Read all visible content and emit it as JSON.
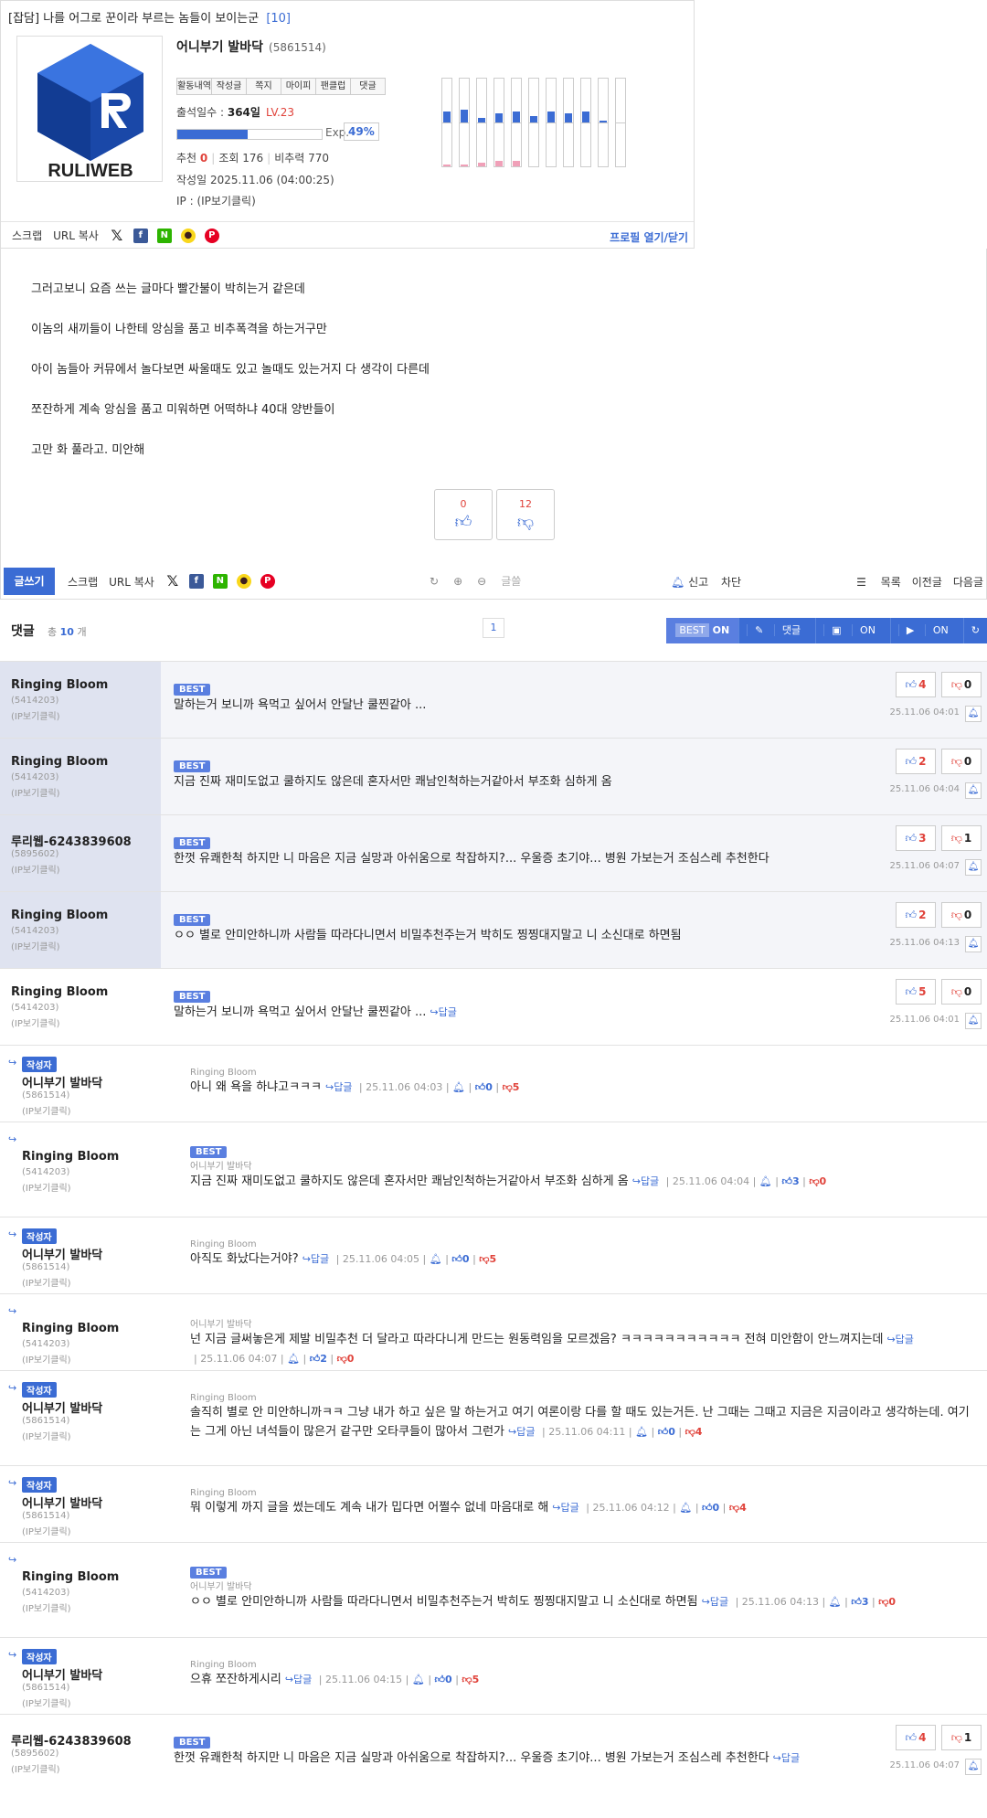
{
  "post": {
    "category": "[잡담]",
    "title": "나를 어그로 꾼이라 부르는 놈들이 보이는군",
    "comment_count": "[10]",
    "logo_text": "RULIWEB",
    "nick": "어니부기 발바닥",
    "uid": "(5861514)",
    "tabs": [
      "활동내역",
      "작성글",
      "쪽지",
      "마이피",
      "팬클럽",
      "댓글"
    ],
    "attend_label": "출석일수 :",
    "attend_value": "364일",
    "level": "LV.23",
    "exp_label": "Exp.",
    "exp_pct": "49%",
    "exp_fraction": 0.49,
    "recommend_label": "추천",
    "recommend": "0",
    "views_label": "조회",
    "views": "176",
    "ratio_label": "비추력",
    "ratio": "770",
    "date_label": "작성일",
    "date": "2025.11.06 (04:00:25)",
    "ip": "IP : (IP보기클릭)",
    "share": {
      "scrap": "스크랩",
      "url_copy": "URL 복사",
      "profile_toggle": "프로필 열기/닫기"
    },
    "activity_bars": [
      {
        "up": 0.25,
        "down": 0.05
      },
      {
        "up": 0.3,
        "down": 0.05
      },
      {
        "up": 0.1,
        "down": 0.08
      },
      {
        "up": 0.2,
        "down": 0.12
      },
      {
        "up": 0.25,
        "down": 0.12
      },
      {
        "up": 0.15,
        "down": 0.0
      },
      {
        "up": 0.25,
        "down": 0.0
      },
      {
        "up": 0.2,
        "down": 0.0
      },
      {
        "up": 0.25,
        "down": 0.0
      },
      {
        "up": 0.05,
        "down": 0.0
      },
      {
        "up": 0.0,
        "down": 0.0
      }
    ],
    "body": [
      "그러고보니 요즘 쓰는 글마다 빨간불이 박히는거 같은데",
      "이놈의 새끼들이 나한테 앙심을 품고 비추폭격을 하는거구만",
      "아이 놈들아 커뮤에서 놀다보면 싸울때도 있고 놀때도 있는거지 다 생각이 다른데",
      "쪼잔하게 계속 앙심을 품고 미워하면 어떡하냐 40대 양반들이",
      "고만 화 풀라고. 미안해"
    ],
    "vote_up": "0",
    "vote_down": "12"
  },
  "bottom_bar": {
    "write": "글쓰기",
    "scrap": "스크랩",
    "url_copy": "URL 복사",
    "search_placeholder": "글쓸",
    "report": "신고",
    "block": "차단",
    "list": "목록",
    "prev": "이전글",
    "next": "다음글"
  },
  "comment_header": {
    "title": "댓글",
    "total_label": "총",
    "total": "10",
    "total_unit": "개",
    "page": "1",
    "best_label": "BEST",
    "best_state": "ON",
    "reply_label": "댓글",
    "img_label": "ON",
    "video_label": "ON"
  },
  "comments": [
    {
      "type": "best",
      "name": "Ringing Bloom",
      "uid": "(5414203)",
      "ip": "(IP보기클릭)",
      "badge": "BEST",
      "text": "말하는거 보니까 욕먹고 싶어서 안달난 쿨찐같아 ...",
      "up": "4",
      "down": "0",
      "time": "25.11.06 04:01"
    },
    {
      "type": "best",
      "name": "Ringing Bloom",
      "uid": "(5414203)",
      "ip": "(IP보기클릭)",
      "badge": "BEST",
      "text": "지금 진짜 재미도없고 쿨하지도 않은데 혼자서만 쾌남인척하는거같아서 부조화 심하게 옴",
      "up": "2",
      "down": "0",
      "time": "25.11.06 04:04"
    },
    {
      "type": "best",
      "name": "루리웹-6243839608",
      "uid": "(5895602)",
      "ip": "(IP보기클릭)",
      "badge": "BEST",
      "text": "한껏 유쾌한척 하지만 니 마음은 지금 실망과 아쉬움으로 착잡하지?... 우울증 초기야... 병원 가보는거 조심스레 추천한다",
      "up": "3",
      "down": "1",
      "time": "25.11.06 04:07"
    },
    {
      "type": "best",
      "name": "Ringing Bloom",
      "uid": "(5414203)",
      "ip": "(IP보기클릭)",
      "badge": "BEST",
      "text": "ㅇㅇ 별로 안미안하니까 사람들 따라다니면서 비밀추천주는거 박히도 찡찡대지말고 니 소신대로 하면됨",
      "up": "2",
      "down": "0",
      "time": "25.11.06 04:13"
    },
    {
      "type": "normal",
      "name": "Ringing Bloom",
      "uid": "(5414203)",
      "ip": "(IP보기클릭)",
      "badge": "BEST",
      "text": "말하는거 보니까 욕먹고 싶어서 안달난 쿨찐같아 ...",
      "reply": "답글",
      "up": "5",
      "down": "0",
      "time": "25.11.06 04:01"
    },
    {
      "type": "reply",
      "author": "작성자",
      "name": "어니부기 발바닥",
      "uid": "(5861514)",
      "ip": "(IP보기클릭)",
      "target": "Ringing Bloom",
      "text": "아니 왜 욕을 하냐고ㅋㅋㅋ",
      "reply": "답글",
      "time": "25.11.06 04:03",
      "up": "0",
      "down": "5"
    },
    {
      "type": "reply",
      "name": "Ringing Bloom",
      "uid": "(5414203)",
      "ip": "(IP보기클릭)",
      "badge": "BEST",
      "target": "어니부기 발바닥",
      "text": "지금 진짜 재미도없고 쿨하지도 않은데 혼자서만 쾌남인척하는거같아서 부조화 심하게 옴",
      "reply": "답글",
      "time": "25.11.06 04:04",
      "up": "3",
      "down": "0"
    },
    {
      "type": "reply",
      "author": "작성자",
      "name": "어니부기 발바닥",
      "uid": "(5861514)",
      "ip": "(IP보기클릭)",
      "target": "Ringing Bloom",
      "text": "아직도 화났다는거야?",
      "reply": "답글",
      "time": "25.11.06 04:05",
      "up": "0",
      "down": "5"
    },
    {
      "type": "reply",
      "name": "Ringing Bloom",
      "uid": "(5414203)",
      "ip": "(IP보기클릭)",
      "target": "어니부기 발바닥",
      "text": "넌 지금 글써놓은게 제발 비밀추천 더 달라고 따라다니게 만드는 원동력임을 모르겠음? ㅋㅋㅋㅋㅋㅋㅋㅋㅋㅋㅋ 전혀 미안함이 안느껴지는데",
      "reply": "답글",
      "time": "25.11.06 04:07",
      "up": "2",
      "down": "0"
    },
    {
      "type": "reply",
      "author": "작성자",
      "name": "어니부기 발바닥",
      "uid": "(5861514)",
      "ip": "(IP보기클릭)",
      "target": "Ringing Bloom",
      "text": "솔직히 별로 안 미안하니까ㅋㅋ 그냥 내가 하고 싶은 말 하는거고 여기 여론이랑 다를 할 때도 있는거든. 난 그때는 그때고 지금은 지금이라고 생각하는데.  여기는 그게 아닌 녀석들이 많은거 같구만 오타쿠들이 많아서 그런가",
      "reply": "답글",
      "time": "25.11.06 04:11",
      "up": "0",
      "down": "4"
    },
    {
      "type": "reply",
      "author": "작성자",
      "name": "어니부기 발바닥",
      "uid": "(5861514)",
      "ip": "(IP보기클릭)",
      "target": "Ringing Bloom",
      "text": "뭐 이렇게 까지 글을 썼는데도 계속 내가 밉다면 어쩔수 없네 마음대로 해",
      "reply": "답글",
      "time": "25.11.06 04:12",
      "up": "0",
      "down": "4"
    },
    {
      "type": "reply",
      "name": "Ringing Bloom",
      "uid": "(5414203)",
      "ip": "(IP보기클릭)",
      "badge": "BEST",
      "target": "어니부기 발바닥",
      "text": "ㅇㅇ 별로 안미안하니까 사람들 따라다니면서 비밀추천주는거 박히도 찡찡대지말고 니 소신대로 하면됨",
      "reply": "답글",
      "time": "25.11.06 04:13",
      "up": "3",
      "down": "0"
    },
    {
      "type": "reply",
      "author": "작성자",
      "name": "어니부기 발바닥",
      "uid": "(5861514)",
      "ip": "(IP보기클릭)",
      "target": "Ringing Bloom",
      "text": "으휴 쪼잔하게시리",
      "reply": "답글",
      "time": "25.11.06 04:15",
      "up": "0",
      "down": "5"
    },
    {
      "type": "normal",
      "name": "루리웹-6243839608",
      "uid": "(5895602)",
      "ip": "(IP보기클릭)",
      "badge": "BEST",
      "text": "한껏 유쾌한척 하지만 니 마음은 지금 실망과 아쉬움으로 착잡하지?... 우울증 초기야... 병원 가보는거 조심스레 추천한다",
      "reply": "답글",
      "up": "4",
      "down": "1",
      "time": "25.11.06 04:07"
    }
  ]
}
